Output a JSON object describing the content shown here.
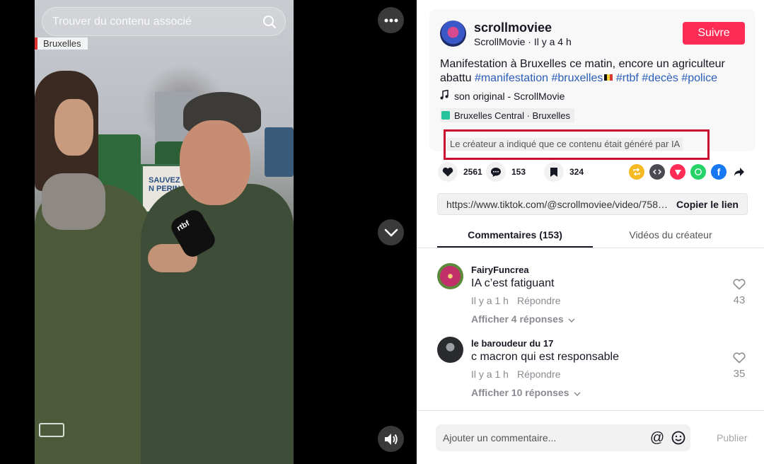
{
  "video": {
    "search": {
      "placeholder": "Trouver du contenu associé"
    },
    "location_tag": "Bruxelles",
    "banner_text": "SAUVEZ N PERIN",
    "mic_logo": "rtbf"
  },
  "post": {
    "username": "scrollmoviee",
    "display_name": "ScrollMovie",
    "time_ago": "Il y a 4 h",
    "follow_label": "Suivre",
    "caption": "Manifestation à Bruxelles ce matin, encore un agriculteur abattu",
    "hashtags": [
      "#manifestation",
      "#bruxelles",
      "#rtbf",
      "#decès",
      "#police"
    ],
    "sound": "son original - ScrollMovie",
    "place": "Bruxelles Central · Bruxelles",
    "ai_notice": "Le créateur a indiqué que ce contenu était généré par IA"
  },
  "stats": {
    "likes": "2561",
    "comments": "153",
    "saves": "324"
  },
  "share_icons": [
    "repost-icon",
    "embed-icon",
    "send-icon",
    "whatsapp-icon",
    "facebook-icon",
    "share-arrow-icon"
  ],
  "link": {
    "url": "https://www.tiktok.com/@scrollmoviee/video/7585...",
    "copy_label": "Copier le lien"
  },
  "tabs": {
    "comments": "Commentaires (153)",
    "creator_videos": "Vidéos du créateur"
  },
  "comments": [
    {
      "user": "FairyFuncrea",
      "text": "IA c’est fatiguant",
      "time": "Il y a 1 h",
      "reply": "Répondre",
      "replies": "Afficher 4 réponses",
      "likes": "43"
    },
    {
      "user": "le baroudeur du 17",
      "text": "c macron qui est responsable",
      "time": "Il y a 1 h",
      "reply": "Répondre",
      "replies": "Afficher 10 réponses",
      "likes": "35"
    }
  ],
  "composer": {
    "placeholder": "Ajouter un commentaire...",
    "publish": "Publier"
  },
  "colors": {
    "follow": "#fe2c55",
    "hashtag": "#2b5db9",
    "highlight_box": "#c8102e"
  }
}
